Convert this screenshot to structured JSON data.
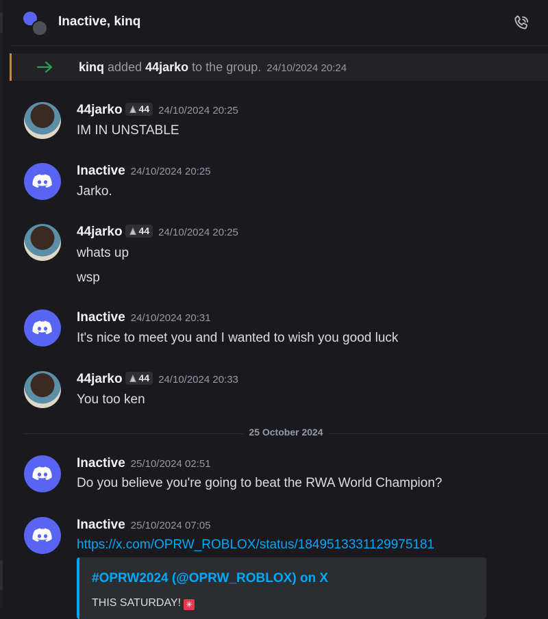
{
  "header": {
    "title": "Inactive, kinq"
  },
  "system_message": {
    "actor": "kinq",
    "action": "added",
    "target": "44jarko",
    "suffix": "to the group.",
    "timestamp": "24/10/2024 20:24"
  },
  "tag": {
    "label": "44"
  },
  "messages": [
    {
      "author": "44jarko",
      "timestamp": "24/10/2024 20:25",
      "lines": [
        "IM IN UNSTABLE"
      ]
    },
    {
      "author": "Inactive",
      "timestamp": "24/10/2024 20:25",
      "lines": [
        "Jarko."
      ]
    },
    {
      "author": "44jarko",
      "timestamp": "24/10/2024 20:25",
      "lines": [
        "whats up",
        "wsp"
      ]
    },
    {
      "author": "Inactive",
      "timestamp": "24/10/2024 20:31",
      "lines": [
        "It's nice to meet you and I wanted to wish you good luck"
      ]
    },
    {
      "author": "44jarko",
      "timestamp": "24/10/2024 20:33",
      "lines": [
        "You too ken"
      ]
    },
    {
      "author": "Inactive",
      "timestamp": "25/10/2024 02:51",
      "lines": [
        "Do you believe you're going to beat the RWA World Champion?"
      ]
    },
    {
      "author": "Inactive",
      "timestamp": "25/10/2024 07:05",
      "lines": [
        "https://x.com/OPRW_ROBLOX/status/1849513331129975181"
      ]
    }
  ],
  "date_divider": "25 October 2024",
  "embed": {
    "title": "#OPRW2024 (@OPRW_ROBLOX) on X",
    "description": "THIS SATURDAY!"
  },
  "colors": {
    "background": "#1a1a1e",
    "accent": "#5865f2",
    "link": "#00a8fc",
    "join_arrow": "#23a559"
  }
}
